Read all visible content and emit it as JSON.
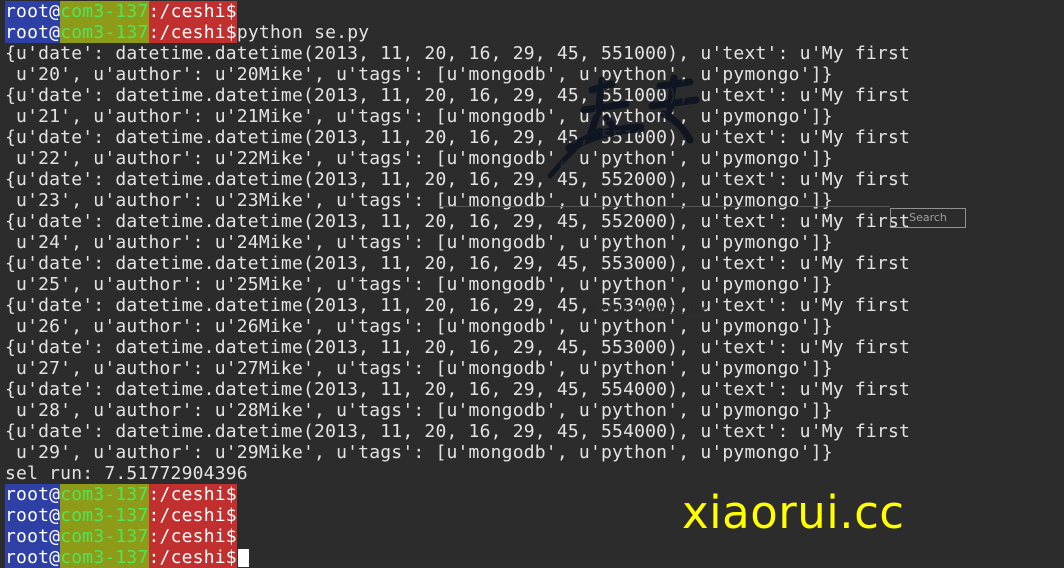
{
  "prompt": {
    "user": "root",
    "at": "@",
    "host": "com3-137",
    "colon": ":",
    "path": "/ceshi",
    "dollar": "$"
  },
  "header_prompt": {
    "path": "/ceshi"
  },
  "command": "python se.py",
  "records": [
    {
      "line1": "{u'date': datetime.datetime(2013, 11, 20, 16, 29, 45, 551000), u'text': u'My first",
      "line2": " u'20', u'author': u'20Mike', u'tags': [u'mongodb', u'python', u'pymongo']}"
    },
    {
      "line1": "{u'date': datetime.datetime(2013, 11, 20, 16, 29, 45, 551000), u'text': u'My first",
      "line2": " u'21', u'author': u'21Mike', u'tags': [u'mongodb', u'python', u'pymongo']}"
    },
    {
      "line1": "{u'date': datetime.datetime(2013, 11, 20, 16, 29, 45, 551000), u'text': u'My first",
      "line2": " u'22', u'author': u'22Mike', u'tags': [u'mongodb', u'python', u'pymongo']}"
    },
    {
      "line1": "{u'date': datetime.datetime(2013, 11, 20, 16, 29, 45, 552000), u'text': u'My first",
      "line2": " u'23', u'author': u'23Mike', u'tags': [u'mongodb', u'python', u'pymongo']}"
    },
    {
      "line1": "{u'date': datetime.datetime(2013, 11, 20, 16, 29, 45, 552000), u'text': u'My first",
      "line2": " u'24', u'author': u'24Mike', u'tags': [u'mongodb', u'python', u'pymongo']}"
    },
    {
      "line1": "{u'date': datetime.datetime(2013, 11, 20, 16, 29, 45, 553000), u'text': u'My first",
      "line2": " u'25', u'author': u'25Mike', u'tags': [u'mongodb', u'python', u'pymongo']}"
    },
    {
      "line1": "{u'date': datetime.datetime(2013, 11, 20, 16, 29, 45, 553000), u'text': u'My first",
      "line2": " u'26', u'author': u'26Mike', u'tags': [u'mongodb', u'python', u'pymongo']}"
    },
    {
      "line1": "{u'date': datetime.datetime(2013, 11, 20, 16, 29, 45, 553000), u'text': u'My first",
      "line2": " u'27', u'author': u'27Mike', u'tags': [u'mongodb', u'python', u'pymongo']}"
    },
    {
      "line1": "{u'date': datetime.datetime(2013, 11, 20, 16, 29, 45, 554000), u'text': u'My first",
      "line2": " u'28', u'author': u'28Mike', u'tags': [u'mongodb', u'python', u'pymongo']}"
    },
    {
      "line1": "{u'date': datetime.datetime(2013, 11, 20, 16, 29, 45, 554000), u'text': u'My first",
      "line2": " u'29', u'author': u'29Mike', u'tags': [u'mongodb', u'python', u'pymongo']}"
    }
  ],
  "timing": "sel run: 7.51772904396",
  "watermark": {
    "search_label": "Search",
    "copyright": "© 2012 WaaaO.com"
  },
  "brand": "xiaorui.cc",
  "colors": {
    "background": "#2c2c2c",
    "text": "#e2e2e2",
    "user_bg": "#2e3fa6",
    "host_bg": "#8e9b18",
    "host_text": "#4ee35a",
    "path_bg": "#c12f2f",
    "brand": "#ffff00"
  }
}
